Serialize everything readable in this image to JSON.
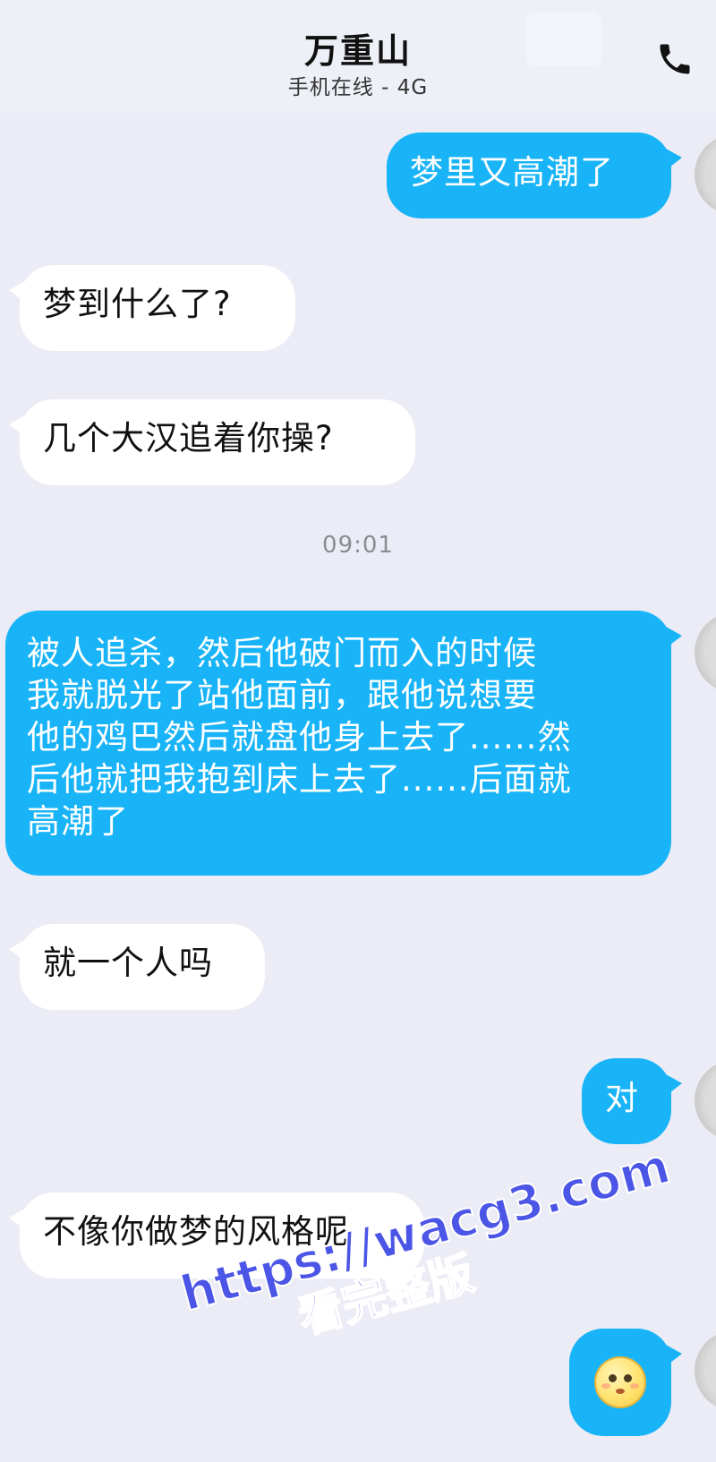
{
  "header": {
    "title": "万重山",
    "subtitle": "手机在线 - 4G",
    "call_icon": "phone-icon"
  },
  "messages": [
    {
      "direction": "outgoing",
      "text": "梦里又高潮了"
    },
    {
      "direction": "incoming",
      "text": "梦到什么了?"
    },
    {
      "direction": "incoming",
      "text": "几个大汉追着你操?"
    },
    {
      "direction": "timestamp",
      "text": "09:01"
    },
    {
      "direction": "outgoing",
      "lines": [
        "被人追杀，然后他破门而入的时候",
        "我就脱光了站他面前，跟他说想要",
        "他的鸡巴然后就盘他身上去了......然",
        "后他就把我抱到床上去了......后面就",
        "高潮了"
      ]
    },
    {
      "direction": "incoming",
      "text": "就一个人吗"
    },
    {
      "direction": "outgoing",
      "text": "对"
    },
    {
      "direction": "incoming",
      "text": "不像你做梦的风格呢"
    },
    {
      "direction": "outgoing",
      "emoji": "shy-face-emoji"
    }
  ],
  "watermark": {
    "url": "https://wacg3.com",
    "sub": "看完整版"
  },
  "colors": {
    "background": "#ebecf5",
    "outgoing_bubble": "#19b4f7",
    "incoming_bubble": "#ffffff",
    "watermark": "#4b55e6"
  }
}
